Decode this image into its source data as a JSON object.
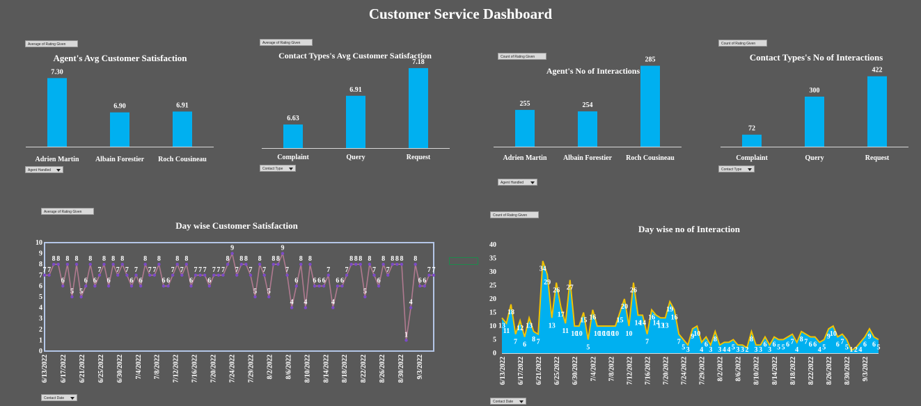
{
  "dashboard_title": "Customer Service Dashboard",
  "filters": {
    "c1_value": "Average of Rating Given",
    "c1_axis": "Agent Handled",
    "c2_value": "Average of Rating Given",
    "c2_axis": "Contact Type",
    "c3_value": "Count of Rating Given",
    "c3_axis": "Agent Handled",
    "c4_value": "Count of Rating Given",
    "c4_axis": "Contact Type",
    "c5_value": "Average of Rating Given",
    "c5_axis": "Contact Date",
    "c6_value": "Count of Rating Given",
    "c6_axis": "Contact Date"
  },
  "colors": {
    "bar": "#00b0f0",
    "line": "#b07a90",
    "marker": "#7c4bc7",
    "area": "#00b0f0",
    "area_line": "#f2c200",
    "plot_border": "#b4c6e7"
  },
  "chart_data": [
    {
      "type": "bar",
      "title": "Agent's Avg Customer Satisfaction",
      "categories": [
        "Adrien Martin",
        "Albain Forestier",
        "Roch Cousineau"
      ],
      "values": [
        7.3,
        6.9,
        6.91
      ],
      "data_labels": [
        "7.30",
        "6.90",
        "6.91"
      ],
      "ylim": [
        6.5,
        7.4
      ]
    },
    {
      "type": "bar",
      "title": "Contact Types's Avg Customer Satisfaction",
      "categories": [
        "Complaint",
        "Query",
        "Request"
      ],
      "values": [
        6.63,
        6.91,
        7.18
      ],
      "data_labels": [
        "6.63",
        "6.91",
        "7.18"
      ],
      "ylim": [
        6.4,
        7.2
      ]
    },
    {
      "type": "bar",
      "title": "Agent's No of Interactions",
      "categories": [
        "Adrien Martin",
        "Albain Forestier",
        "Roch Cousineau"
      ],
      "values": [
        255,
        254,
        285
      ],
      "data_labels": [
        "255",
        "254",
        "285"
      ],
      "ylim": [
        230,
        290
      ]
    },
    {
      "type": "bar",
      "title": "Contact Types's No of Interactions",
      "categories": [
        "Complaint",
        "Query",
        "Request"
      ],
      "values": [
        72,
        300,
        422
      ],
      "data_labels": [
        "72",
        "300",
        "422"
      ],
      "ylim": [
        0,
        450
      ]
    },
    {
      "type": "line",
      "title": "Day wise Customer Satisfaction",
      "ylim": [
        0,
        10
      ],
      "y_ticks": [
        "0",
        "1",
        "2",
        "3",
        "4",
        "5",
        "6",
        "7",
        "8",
        "9",
        "10"
      ],
      "x_ticks": [
        "6/13/2022",
        "6/17/2022",
        "6/21/2022",
        "6/25/2022",
        "6/30/2022",
        "7/4/2022",
        "7/8/2022",
        "7/12/2022",
        "7/16/2022",
        "7/20/2022",
        "7/24/2022",
        "7/29/2022",
        "8/2/2022",
        "8/6/2022",
        "8/10/2022",
        "8/14/2022",
        "8/18/2022",
        "8/22/2022",
        "8/26/2022",
        "8/30/2022",
        "9/3/2022"
      ],
      "values": [
        7,
        7,
        8,
        8,
        6,
        8,
        5,
        8,
        5,
        6,
        8,
        6,
        7,
        8,
        6,
        8,
        7,
        8,
        7,
        6,
        7,
        6,
        8,
        7,
        7,
        8,
        6,
        6,
        7,
        8,
        7,
        8,
        6,
        7,
        7,
        7,
        6,
        7,
        7,
        7,
        8,
        9,
        7,
        8,
        8,
        7,
        5,
        8,
        7,
        5,
        8,
        8,
        9,
        7,
        4,
        6,
        8,
        4,
        8,
        6,
        6,
        6,
        7,
        4,
        6,
        6,
        7,
        8,
        8,
        8,
        5,
        8,
        7,
        6,
        8,
        7,
        8,
        8,
        8,
        1,
        4,
        8,
        6,
        6,
        7,
        7
      ],
      "data_labels": [
        "7",
        "7",
        "8",
        "8",
        "6",
        "8",
        "5",
        "8",
        "5",
        "6",
        "8",
        "6",
        "7",
        "8",
        "6",
        "8",
        "7",
        "8",
        "7",
        "6",
        "7",
        "6",
        "8",
        "7",
        "7",
        "8",
        "6",
        "6",
        "7",
        "8",
        "7",
        "8",
        "6",
        "7",
        "7",
        "7",
        "6",
        "7",
        "7",
        "7",
        "8",
        "9",
        "7",
        "8",
        "8",
        "7",
        "5",
        "8",
        "7",
        "5",
        "8",
        "8",
        "9",
        "7",
        "4",
        "6",
        "8",
        "4",
        "8",
        "6",
        "6",
        "6",
        "7",
        "4",
        "6",
        "6",
        "7",
        "8",
        "8",
        "8",
        "5",
        "8",
        "7",
        "6",
        "8",
        "7",
        "8",
        "8",
        "8",
        "1",
        "4",
        "8",
        "6",
        "6",
        "7",
        "7"
      ]
    },
    {
      "type": "area",
      "title": "Day wise no of Interaction",
      "ylim": [
        0,
        40
      ],
      "y_ticks": [
        "0",
        "5",
        "10",
        "15",
        "20",
        "25",
        "30",
        "35",
        "40"
      ],
      "x_ticks": [
        "6/13/2022",
        "6/17/2022",
        "6/21/2022",
        "6/25/2022",
        "6/30/2022",
        "7/4/2022",
        "7/8/2022",
        "7/12/2022",
        "7/16/2022",
        "7/20/2022",
        "7/24/2022",
        "7/29/2022",
        "8/2/2022",
        "8/6/2022",
        "8/10/2022",
        "8/14/2022",
        "8/18/2022",
        "8/22/2022",
        "8/26/2022",
        "8/30/2022",
        "9/3/2022"
      ],
      "values": [
        13,
        11,
        18,
        7,
        12,
        6,
        13,
        8,
        7,
        34,
        29,
        13,
        26,
        17,
        11,
        27,
        10,
        10,
        15,
        5,
        16,
        10,
        10,
        10,
        10,
        10,
        15,
        20,
        10,
        26,
        14,
        14,
        7,
        16,
        14,
        13,
        13,
        19,
        16,
        7,
        5,
        3,
        9,
        10,
        4,
        6,
        3,
        8,
        3,
        4,
        4,
        5,
        3,
        3,
        2,
        8,
        3,
        3,
        6,
        3,
        6,
        5,
        5,
        6,
        7,
        4,
        8,
        7,
        6,
        6,
        4,
        5,
        9,
        10,
        6,
        7,
        5,
        1,
        2,
        4,
        6,
        9,
        6,
        5
      ],
      "data_labels": [
        "13",
        "11",
        "18",
        "7",
        "12",
        "6",
        "13",
        "8",
        "7",
        "34",
        "29",
        "13",
        "26",
        "17",
        "11",
        "27",
        "10",
        "10",
        "15",
        "5",
        "16",
        "10",
        "10",
        "10",
        "10",
        "10",
        "15",
        "20",
        "10",
        "26",
        "14",
        "14",
        "7",
        "16",
        "14",
        "13",
        "13",
        "19",
        "16",
        "7",
        "5",
        "3",
        "9",
        "10",
        "4",
        "6",
        "3",
        "8",
        "3",
        "4",
        "4",
        "5",
        "3",
        "3",
        "2",
        "8",
        "3",
        "3",
        "6",
        "3",
        "6",
        "5",
        "5",
        "6",
        "7",
        "4",
        "8",
        "7",
        "6",
        "6",
        "4",
        "5",
        "9",
        "10",
        "6",
        "7",
        "5",
        "1",
        "2",
        "4",
        "6",
        "9",
        "6",
        "5"
      ]
    }
  ]
}
